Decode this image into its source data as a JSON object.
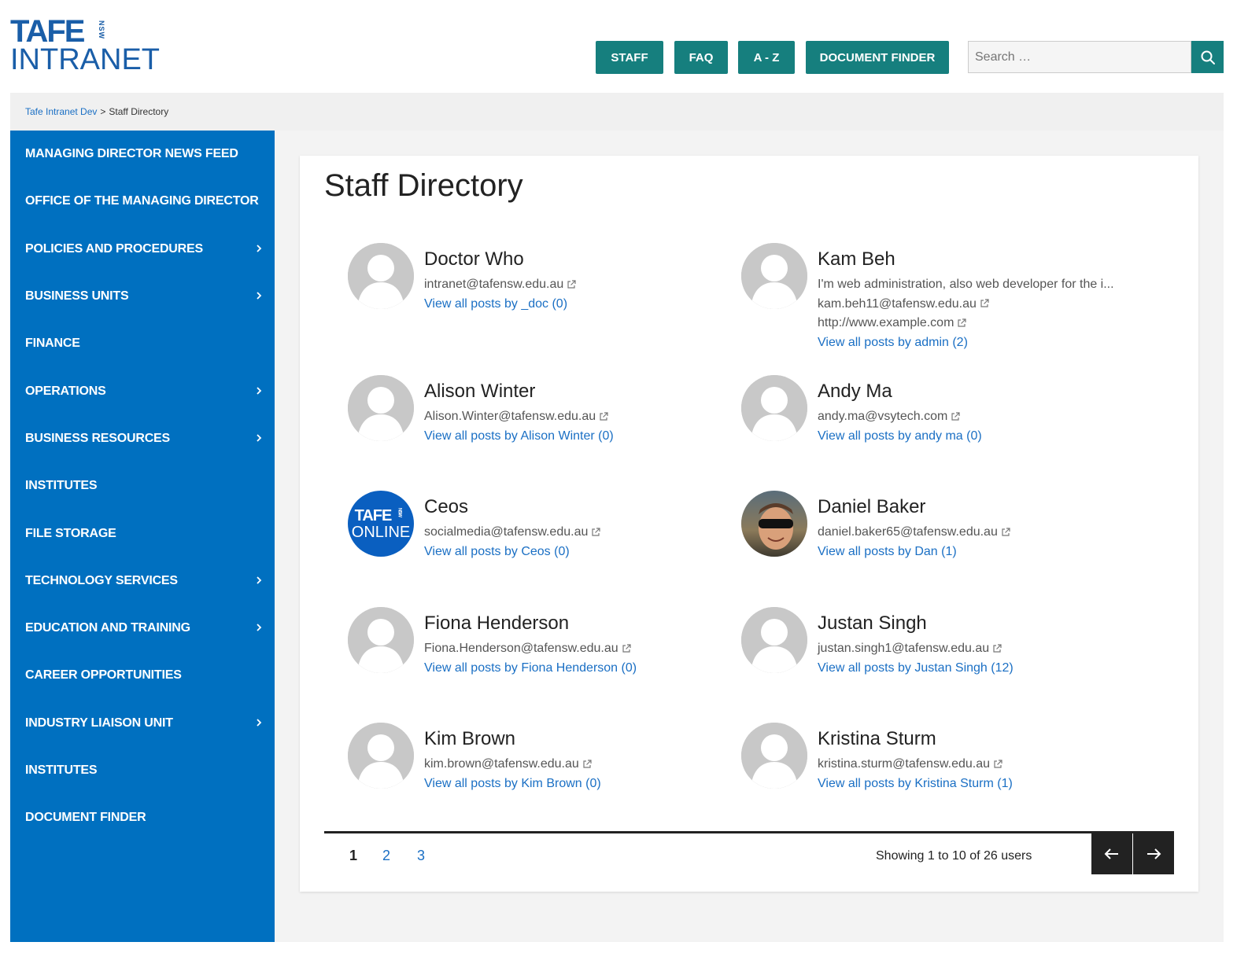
{
  "logo": {
    "tafe": "TAFE",
    "nsw": "NSW",
    "intranet": "INTRANET"
  },
  "header": {
    "nav": [
      "STAFF",
      "FAQ",
      "A - Z",
      "DOCUMENT FINDER"
    ],
    "search_placeholder": "Search …"
  },
  "breadcrumb": {
    "home": "Tafe Intranet Dev",
    "separator": ">",
    "current": "Staff Directory"
  },
  "sidebar": {
    "items": [
      {
        "label": "MANAGING DIRECTOR NEWS FEED",
        "has_children": false
      },
      {
        "label": "OFFICE OF THE MANAGING DIRECTOR",
        "has_children": false
      },
      {
        "label": "POLICIES AND PROCEDURES",
        "has_children": true
      },
      {
        "label": "BUSINESS UNITS",
        "has_children": true
      },
      {
        "label": "FINANCE",
        "has_children": false
      },
      {
        "label": "OPERATIONS",
        "has_children": true
      },
      {
        "label": "BUSINESS RESOURCES",
        "has_children": true
      },
      {
        "label": "INSTITUTES",
        "has_children": false
      },
      {
        "label": "FILE STORAGE",
        "has_children": false
      },
      {
        "label": "TECHNOLOGY SERVICES",
        "has_children": true
      },
      {
        "label": "EDUCATION AND TRAINING",
        "has_children": true
      },
      {
        "label": "CAREER OPPORTUNITIES",
        "has_children": false
      },
      {
        "label": "INDUSTRY LIAISON UNIT",
        "has_children": true
      },
      {
        "label": "INSTITUTES",
        "has_children": false
      },
      {
        "label": "DOCUMENT FINDER",
        "has_children": false
      }
    ]
  },
  "main": {
    "title": "Staff Directory",
    "people": [
      {
        "name": "Doctor Who",
        "email": "intranet@tafensw.edu.au",
        "posts": "View all posts by _doc (0)",
        "avatar": "default"
      },
      {
        "name": "Kam Beh",
        "bio": "I'm web administration, also web developer for the i...",
        "email": "kam.beh11@tafensw.edu.au",
        "website": "http://www.example.com",
        "posts": "View all posts by admin (2)",
        "avatar": "default"
      },
      {
        "name": "Alison Winter",
        "email": "Alison.Winter@tafensw.edu.au",
        "posts": "View all posts by Alison Winter (0)",
        "avatar": "default"
      },
      {
        "name": "Andy Ma",
        "email": "andy.ma@vsytech.com",
        "posts": "View all posts by andy ma (0)",
        "avatar": "default"
      },
      {
        "name": "Ceos",
        "email": "socialmedia@tafensw.edu.au",
        "posts": "View all posts by Ceos (0)",
        "avatar": "tafe-online-logo",
        "avatar_text": {
          "tafe": "TAFE",
          "nsw": "NSW",
          "online": "ONLINE"
        }
      },
      {
        "name": "Daniel Baker",
        "email": "daniel.baker65@tafensw.edu.au",
        "posts": "View all posts by Dan (1)",
        "avatar": "photo"
      },
      {
        "name": "Fiona Henderson",
        "email": "Fiona.Henderson@tafensw.edu.au",
        "posts": "View all posts by Fiona Henderson (0)",
        "avatar": "default"
      },
      {
        "name": "Justan Singh",
        "email": "justan.singh1@tafensw.edu.au",
        "posts": "View all posts by Justan Singh (12)",
        "avatar": "default"
      },
      {
        "name": "Kim Brown",
        "email": "kim.brown@tafensw.edu.au",
        "posts": "View all posts by Kim Brown (0)",
        "avatar": "default"
      },
      {
        "name": "Kristina Sturm",
        "email": "kristina.sturm@tafensw.edu.au",
        "posts": "View all posts by Kristina Sturm (1)",
        "avatar": "default"
      }
    ]
  },
  "pagination": {
    "pages": [
      "1",
      "2",
      "3"
    ],
    "current": "1",
    "showing": "Showing 1 to 10 of 26 users"
  },
  "colors": {
    "teal": "#167f7e",
    "sidebar_blue": "#0070c0",
    "link_blue": "#1a6fc4",
    "logo_blue": "#1a5ea8"
  },
  "icons": {
    "search": "search-icon",
    "external": "external-link-icon",
    "chevron": "chevron-right-icon",
    "prev": "arrow-left-icon",
    "next": "arrow-right-icon"
  }
}
